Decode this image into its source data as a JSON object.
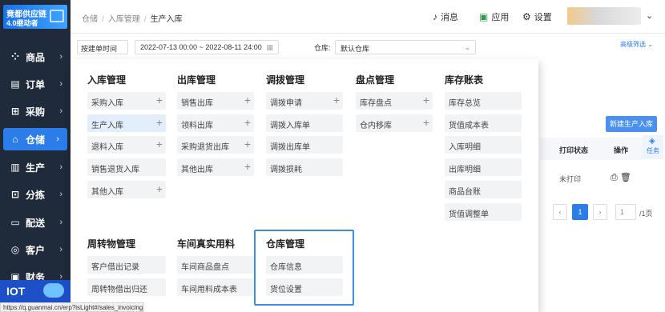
{
  "logo": {
    "line1": "竟都供应链",
    "line2": "4.0继动者"
  },
  "sidebar": {
    "items": [
      {
        "icon": "grid-icon",
        "glyph": "⁘",
        "label": "商品"
      },
      {
        "icon": "clipboard-icon",
        "glyph": "▤",
        "label": "订单"
      },
      {
        "icon": "cart-icon",
        "glyph": "⊞",
        "label": "采购"
      },
      {
        "icon": "warehouse-icon",
        "glyph": "⌂",
        "label": "仓储"
      },
      {
        "icon": "factory-icon",
        "glyph": "▥",
        "label": "生产"
      },
      {
        "icon": "sort-icon",
        "glyph": "⊡",
        "label": "分拣"
      },
      {
        "icon": "truck-icon",
        "glyph": "▭",
        "label": "配送"
      },
      {
        "icon": "user-icon",
        "glyph": "◎",
        "label": "客户"
      },
      {
        "icon": "finance-icon",
        "glyph": "▣",
        "label": "财务"
      }
    ],
    "arrow": "›",
    "iot": "IOT"
  },
  "breadcrumb": {
    "root": "仓储",
    "mid": "入库管理",
    "current": "生产入库",
    "sep": "/"
  },
  "topbar": {
    "messages": "消息",
    "apps": "应用",
    "settings": "设置",
    "chevron": "⌄"
  },
  "filter": {
    "time_type": "按建单时间",
    "date_range": "2022-07-13 00:00 ~ 2022-08-11 24:00",
    "warehouse_label": "仓库:",
    "warehouse_value": "默认仓库",
    "advanced": "高级筛选 ⌄"
  },
  "page": {
    "new_button": "新建生产入库",
    "task": "任务",
    "col_print": "打印状态",
    "col_ops": "操作",
    "row_print": "未打印",
    "row_ops": "⎙ 🗑",
    "pager": {
      "prev": "‹",
      "page": "1",
      "next": "›",
      "jump": "1",
      "total": "/1页"
    }
  },
  "menu": {
    "inbound": {
      "title": "入库管理",
      "items": [
        "采购入库",
        "生产入库",
        "退料入库",
        "销售退货入库",
        "其他入库"
      ]
    },
    "outbound": {
      "title": "出库管理",
      "items": [
        "销售出库",
        "领料出库",
        "采购退货出库",
        "其他出库"
      ]
    },
    "transfer": {
      "title": "调拨管理",
      "items": [
        "调拨申请",
        "调拨入库单",
        "调拨出库单",
        "调拨损耗"
      ]
    },
    "stocktake": {
      "title": "盘点管理",
      "items": [
        "库存盘点",
        "仓内移库"
      ]
    },
    "ledger": {
      "title": "库存账表",
      "items": [
        "库存总览",
        "货值成本表",
        "入库明细",
        "出库明细",
        "商品台账",
        "货值调整单"
      ]
    },
    "turnover": {
      "title": "周转物管理",
      "items": [
        "客户借出记录",
        "周转物借出归还"
      ]
    },
    "workshop": {
      "title": "车间真实用料",
      "items": [
        "车间商品盘点",
        "车间用料成本表"
      ]
    },
    "warehouse": {
      "title": "仓库管理",
      "items": [
        "仓库信息",
        "货位设置"
      ]
    },
    "plus": "+"
  },
  "status_url": "https://q.guanmai.cn/erp?isLight#/sales_invoicing"
}
